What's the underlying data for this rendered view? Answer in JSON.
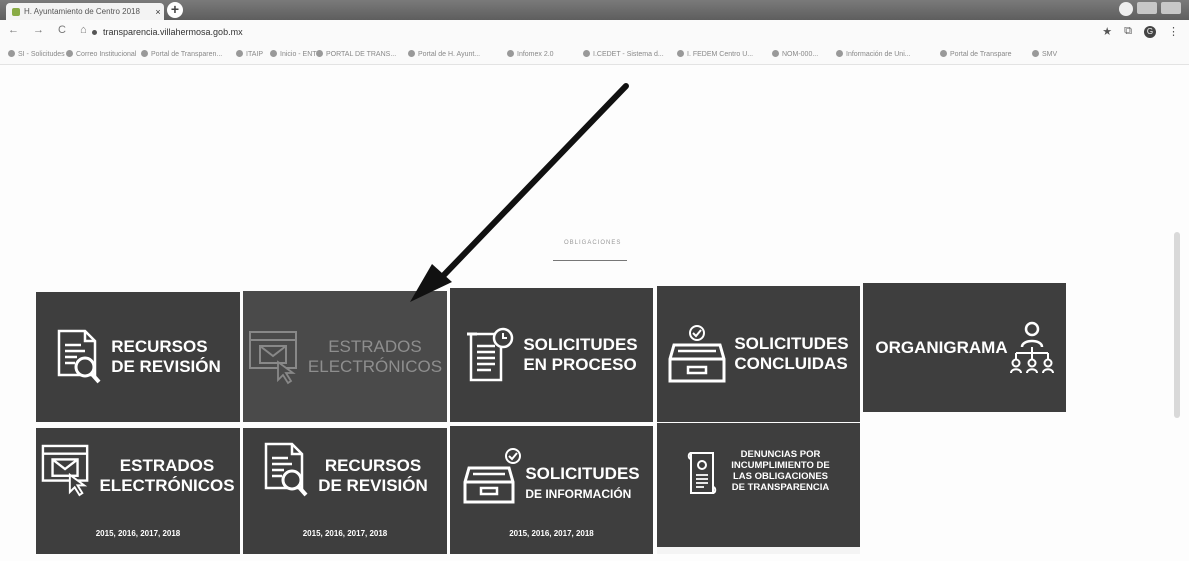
{
  "browser": {
    "tab_title": "H. Ayuntamiento de Centro 2018",
    "tab_close": "×",
    "new_tab": "+",
    "url": "transparencia.villahermosa.gob.mx",
    "nav": {
      "back": "←",
      "forward": "→",
      "reload": "C",
      "home": "⌂"
    },
    "right": {
      "star": "★",
      "ext": "⧉",
      "profile": "G",
      "menu": "⋮"
    },
    "bookmarks": [
      "SI - Solicitudes",
      "Correo Institucional",
      "Portal de Transparen...",
      "ITAIP",
      "Inicio - ENT",
      "PORTAL DE TRANS...",
      "Portal de H. Ayunt...",
      "Infomex 2.0",
      "I.CEDET - Sistema d...",
      "I. FEDEM Centro U...",
      "NOM-000...",
      "Información de Uni...",
      "Portal de Transpare",
      "SMV"
    ]
  },
  "page": {
    "section_label": "OBLIGACIONES"
  },
  "tiles": {
    "t1": {
      "label": "RECURSOS\nDE REVISIÓN"
    },
    "t2": {
      "label": "ESTRADOS\nELECTRÓNICOS"
    },
    "t3": {
      "label": "SOLICITUDES\nEN PROCESO"
    },
    "t4": {
      "label": "SOLICITUDES\nCONCLUIDAS"
    },
    "t5": {
      "label": "ORGANIGRAMA"
    },
    "t6": {
      "label": "ESTRADOS\nELECTRÓNICOS",
      "years": "2015, 2016, 2017, 2018"
    },
    "t7": {
      "label": "RECURSOS\nDE REVISIÓN",
      "years": "2015, 2016, 2017, 2018"
    },
    "t8": {
      "label": "SOLICITUDES",
      "sub": "DE INFORMACIÓN",
      "years": "2015, 2016, 2017, 2018"
    },
    "t9": {
      "label": "DENUNCIAS POR\nINCUMPLIMIENTO DE\nLAS OBLIGACIONES\nDE TRANSPARENCIA"
    }
  },
  "colors": {
    "tile": "#3e3e3e",
    "tile_hover": "#4a4a4a",
    "arrow": "#111111"
  }
}
